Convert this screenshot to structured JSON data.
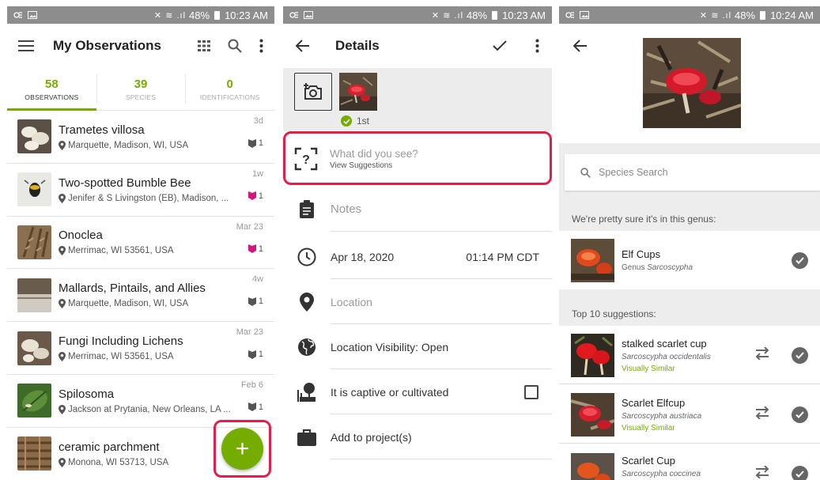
{
  "colors": {
    "accent": "#74ac00",
    "highlight": "#e0204a",
    "status_bar": "#8d8d8d"
  },
  "panel1": {
    "status": {
      "battery": "48%",
      "time": "10:23 AM"
    },
    "title": "My Observations",
    "tabs": [
      {
        "count": "58",
        "label": "OBSERVATIONS",
        "active": true
      },
      {
        "count": "39",
        "label": "SPECIES",
        "active": false
      },
      {
        "count": "0",
        "label": "IDENTIFICATIONS",
        "active": false
      }
    ],
    "observations": [
      {
        "name": "Trametes villosa",
        "location": "Marquette, Madison, WI, USA",
        "date": "3d",
        "ids": "1",
        "id_color": "#555555",
        "thumb": "mushroom-white"
      },
      {
        "name": "Two-spotted Bumble Bee",
        "location": "Jenifer & S Livingston (EB), Madison, ...",
        "date": "1w",
        "ids": "1",
        "id_color": "#d4157c",
        "thumb": "bee"
      },
      {
        "name": "Onoclea",
        "location": "Merrimac, WI 53561, USA",
        "date": "Mar 23",
        "ids": "1",
        "id_color": "#d4157c",
        "thumb": "fern"
      },
      {
        "name": "Mallards, Pintails, and Allies",
        "location": "Marquette, Madison, WI, USA",
        "date": "4w",
        "ids": "1",
        "id_color": "#555555",
        "thumb": "duck"
      },
      {
        "name": "Fungi Including Lichens",
        "location": "Merrimac, WI 53561, USA",
        "date": "Mar 23",
        "ids": "1",
        "id_color": "#555555",
        "thumb": "fungi"
      },
      {
        "name": "Spilosoma",
        "location": "Jackson at Prytania, New Orleans, LA ...",
        "date": "Feb 6",
        "ids": "1",
        "id_color": "#555555",
        "thumb": "leaf"
      },
      {
        "name": "ceramic parchment",
        "location": "Monona, WI 53713, USA",
        "date": "",
        "ids": "",
        "id_color": "#555555",
        "thumb": "wood"
      }
    ],
    "fab_label": "+"
  },
  "panel2": {
    "status": {
      "battery": "48%",
      "time": "10:23 AM"
    },
    "title": "Details",
    "photo_badge": "1st",
    "what_did_you_see": "What did you see?",
    "view_suggestions": "View Suggestions",
    "notes_placeholder": "Notes",
    "date": "Apr 18, 2020",
    "time": "01:14 PM CDT",
    "location_placeholder": "Location",
    "location_visibility": "Location Visibility: Open",
    "captive": "It is captive or cultivated",
    "add_project": "Add to project(s)"
  },
  "panel3": {
    "status": {
      "battery": "48%",
      "time": "10:24 AM"
    },
    "search_placeholder": "Species Search",
    "genus_label": "We're pretty sure it's in this genus:",
    "genus": {
      "name": "Elf Cups",
      "rank": "Genus",
      "sci": "Sarcoscypha"
    },
    "top_label": "Top 10 suggestions:",
    "suggestions": [
      {
        "name": "stalked scarlet cup",
        "sci": "Sarcoscypha occidentalis",
        "visual": "Visually Similar"
      },
      {
        "name": "Scarlet Elfcup",
        "sci": "Sarcoscypha austriaca",
        "visual": "Visually Similar"
      },
      {
        "name": "Scarlet Cup",
        "sci": "Sarcoscypha coccinea",
        "visual": ""
      }
    ]
  }
}
